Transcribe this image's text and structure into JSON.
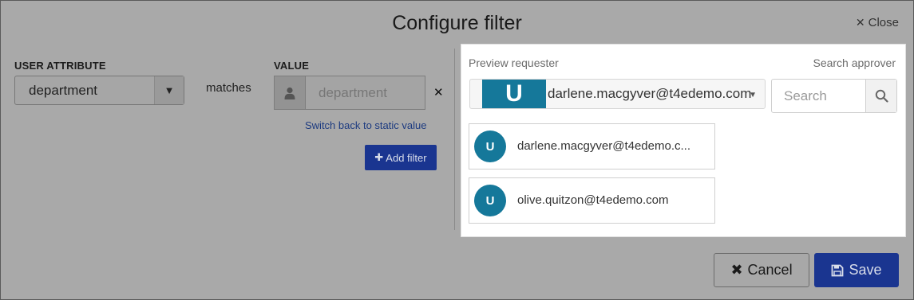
{
  "dialog": {
    "title": "Configure filter",
    "close_label": "Close"
  },
  "filter": {
    "attribute_heading": "USER ATTRIBUTE",
    "attribute_value": "department",
    "operator": "matches",
    "value_heading": "VALUE",
    "value_placeholder": "department",
    "switch_link": "Switch back to static value",
    "add_filter_label": "Add filter"
  },
  "preview": {
    "requester_label": "Preview requester",
    "approver_label": "Search approver",
    "requester_badge": "U",
    "requester_email": "darlene.macgyver@t4edemo.com",
    "search_placeholder": "Search",
    "results": [
      {
        "initial": "U",
        "email": "darlene.macgyver@t4edemo.c..."
      },
      {
        "initial": "U",
        "email": "olive.quitzon@t4edemo.com"
      }
    ]
  },
  "footer": {
    "cancel_label": "Cancel",
    "save_label": "Save"
  },
  "colors": {
    "accent": "#1a3590",
    "avatar": "#15789a"
  }
}
